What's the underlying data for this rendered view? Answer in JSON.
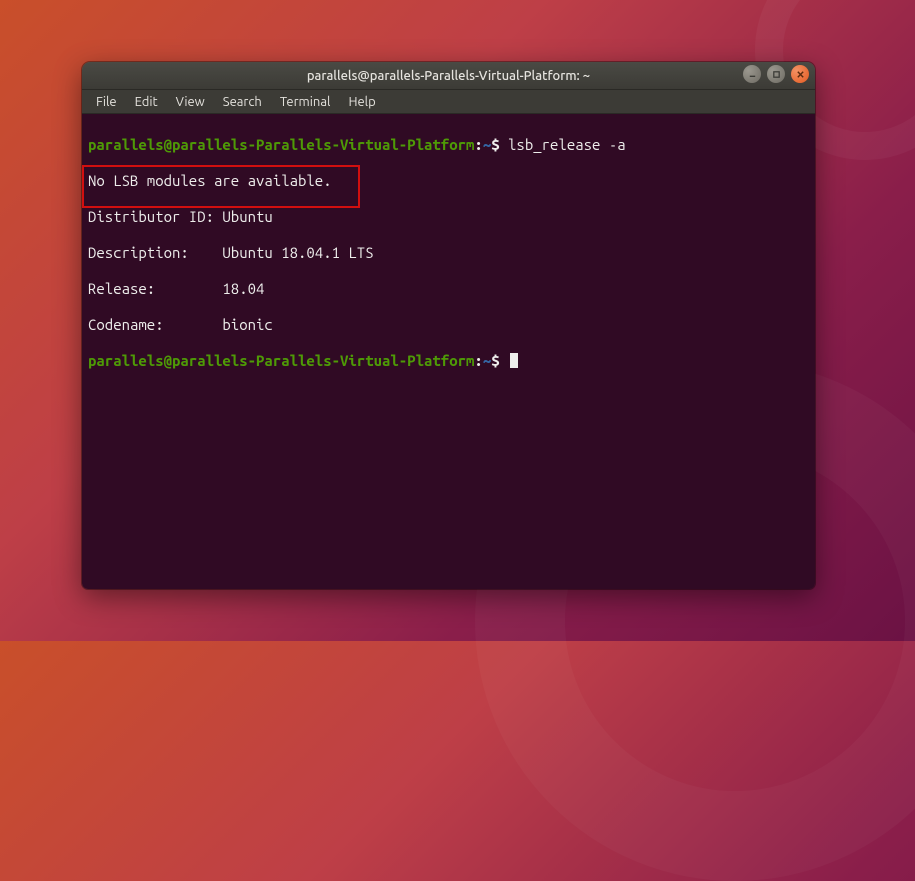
{
  "window": {
    "title": "parallels@parallels-Parallels-Virtual-Platform: ~"
  },
  "menu": {
    "items": [
      "File",
      "Edit",
      "View",
      "Search",
      "Terminal",
      "Help"
    ]
  },
  "prompt": {
    "user_host": "parallels@parallels-Parallels-Virtual-Platform",
    "colon": ":",
    "path": "~",
    "dollar": "$"
  },
  "session": {
    "command1": "lsb_release -a",
    "out1": "No LSB modules are available.",
    "out2": "Distributor ID: Ubuntu",
    "out3": "Description:    Ubuntu 18.04.1 LTS",
    "out4": "Release:        18.04",
    "out5": "Codename:       bionic"
  },
  "win_controls": {
    "minimize": "minimize",
    "maximize": "maximize",
    "close": "close"
  }
}
